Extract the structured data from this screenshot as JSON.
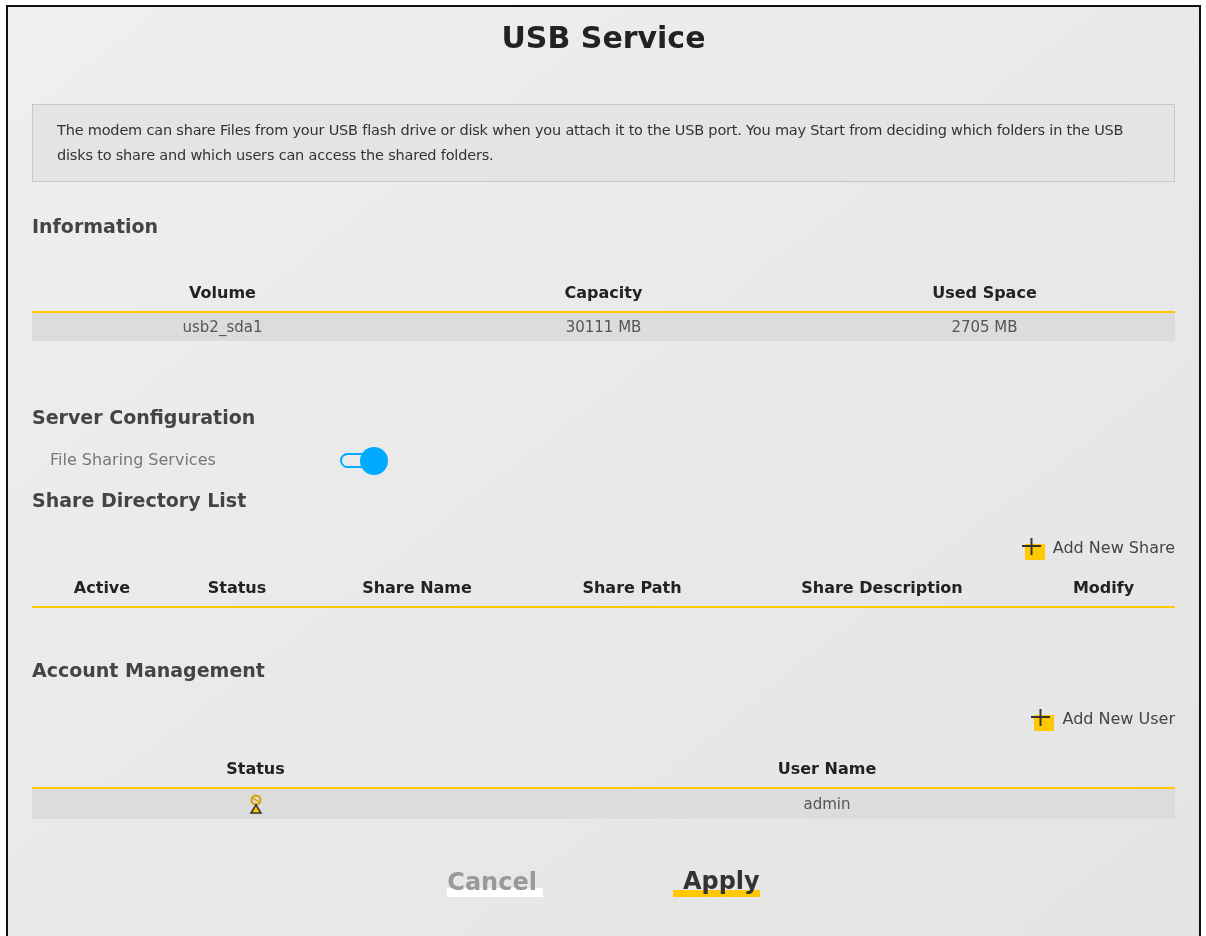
{
  "title": "USB Service",
  "description": "The modem can share Files from your USB flash drive or disk when you attach it to the USB port. You may Start from deciding which folders in the USB disks to share and which users can access the shared folders.",
  "information": {
    "heading": "Information",
    "columns": [
      "Volume",
      "Capacity",
      "Used Space"
    ],
    "rows": [
      [
        "usb2_sda1",
        "30111 MB",
        "2705 MB"
      ]
    ]
  },
  "server_configuration": {
    "heading": "Server Configuration",
    "file_sharing_services": {
      "label": "File Sharing Services",
      "on": true
    }
  },
  "share_directory_list": {
    "heading": "Share Directory List",
    "add_button": "Add New Share",
    "columns": [
      "Active",
      "Status",
      "Share Name",
      "Share Path",
      "Share Description",
      "Modify"
    ]
  },
  "account_management": {
    "heading": "Account Management",
    "add_button": "Add New User",
    "columns": [
      "Status",
      "User Name"
    ],
    "rows": [
      {
        "kind": "user",
        "user_name": "admin"
      }
    ]
  },
  "buttons": [
    {
      "label": "Cancel",
      "kind": "secondary"
    },
    {
      "label": "Apply",
      "kind": "primary"
    }
  ]
}
